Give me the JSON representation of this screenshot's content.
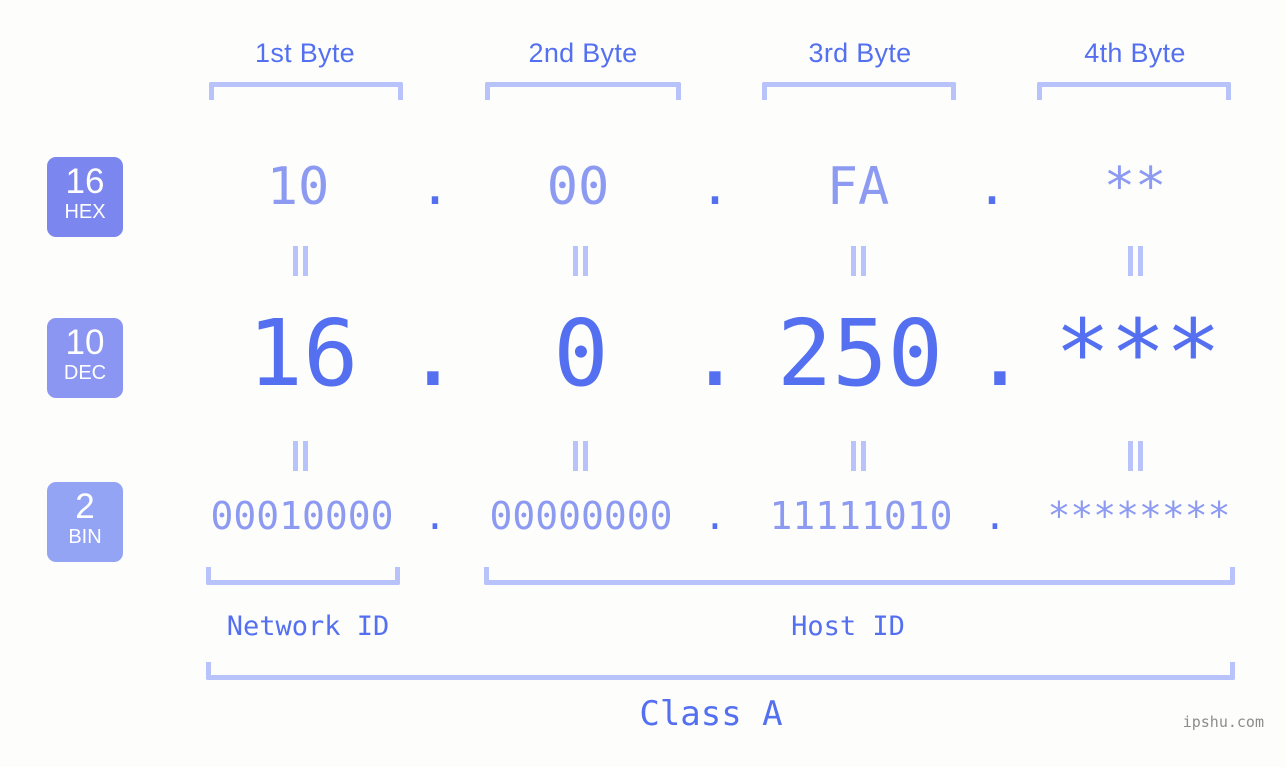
{
  "headers": [
    {
      "label": "1st Byte"
    },
    {
      "label": "2nd Byte"
    },
    {
      "label": "3rd Byte"
    },
    {
      "label": "4th Byte"
    }
  ],
  "bases": [
    {
      "num": "16",
      "label": "HEX",
      "color": "#7b86ef"
    },
    {
      "num": "10",
      "label": "DEC",
      "color": "#8b95f2"
    },
    {
      "num": "2",
      "label": "BIN",
      "color": "#93a4f5"
    }
  ],
  "rows": {
    "hex": {
      "base_num": "16",
      "base_label": "HEX",
      "values": [
        "10",
        "00",
        "FA",
        "**"
      ],
      "separator": "."
    },
    "dec": {
      "base_num": "10",
      "base_label": "DEC",
      "values": [
        "16",
        "0",
        "250",
        "***"
      ],
      "separator": "."
    },
    "bin": {
      "base_num": "2",
      "base_label": "BIN",
      "values": [
        "00010000",
        "00000000",
        "11111010",
        "********"
      ],
      "separator": "."
    }
  },
  "segments": {
    "network_id": "Network ID",
    "host_id": "Host ID"
  },
  "class_label": "Class A",
  "watermark": "ipshu.com",
  "colors": {
    "accent_strong": "#5470f0",
    "accent_light": "#8c9af2",
    "bracket": "#b8c2fb",
    "background": "#fdfefb",
    "watermark": "#8c8c8c"
  }
}
